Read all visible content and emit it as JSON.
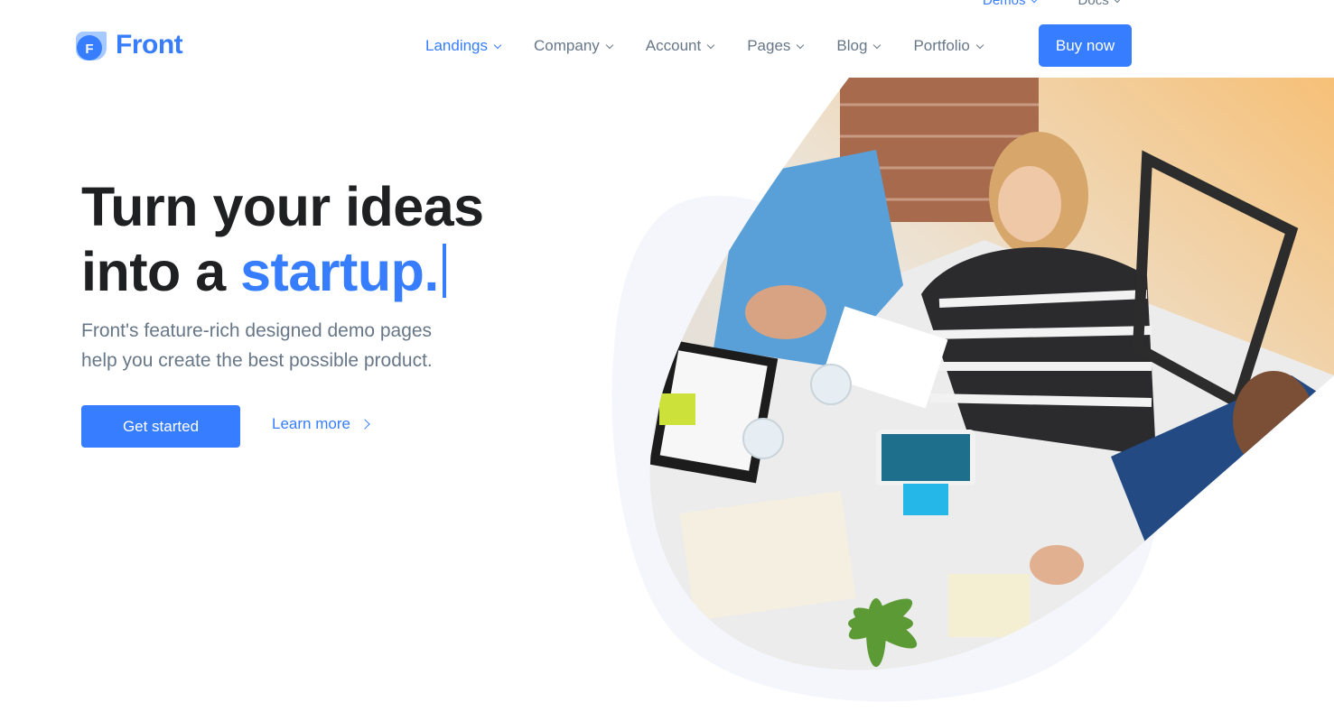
{
  "topbar": {
    "items": [
      {
        "label": "Demos",
        "active": true
      },
      {
        "label": "Docs",
        "active": false
      }
    ]
  },
  "brand": {
    "name": "Front",
    "mark_letter": "F",
    "accent_color": "#377dff",
    "heading_color": "#1e2022",
    "muted_color": "#677788"
  },
  "nav": {
    "items": [
      {
        "label": "Landings",
        "active": true
      },
      {
        "label": "Company",
        "active": false
      },
      {
        "label": "Account",
        "active": false
      },
      {
        "label": "Pages",
        "active": false
      },
      {
        "label": "Blog",
        "active": false
      },
      {
        "label": "Portfolio",
        "active": false
      }
    ],
    "buy_label": "Buy now"
  },
  "hero": {
    "title_line1": "Turn your ideas",
    "title_line2_prefix": "into a ",
    "title_highlight": "startup.",
    "subtitle_line1": "Front's feature-rich designed demo pages",
    "subtitle_line2": "help you create the best possible product.",
    "primary_cta": "Get started",
    "secondary_cta": "Learn more"
  },
  "hero_image": {
    "icon": "team-meeting-photo"
  }
}
